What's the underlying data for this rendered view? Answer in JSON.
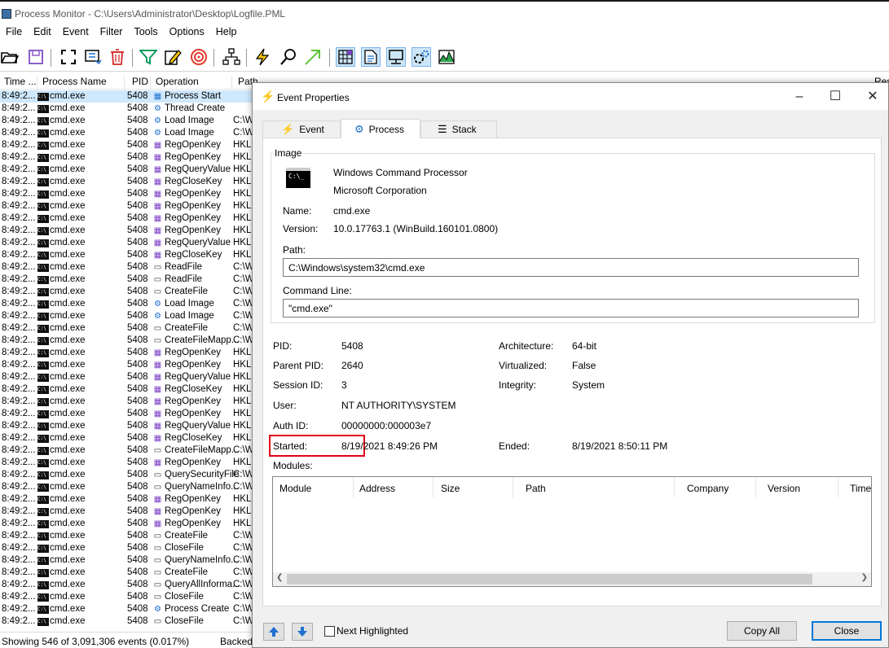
{
  "window": {
    "title": "Process Monitor - C:\\Users\\Administrator\\Desktop\\Logfile.PML"
  },
  "menu": [
    "File",
    "Edit",
    "Event",
    "Filter",
    "Tools",
    "Options",
    "Help"
  ],
  "list": {
    "headers": {
      "time": "Time ...",
      "process": "Process Name",
      "pid": "PID",
      "operation": "Operation",
      "path": "Path",
      "result": "Res"
    },
    "rows": [
      {
        "time": "8:49:2...",
        "proc": "cmd.exe",
        "pid": "5408",
        "icon": "proc",
        "op": "Process Start",
        "path": ""
      },
      {
        "time": "8:49:2...",
        "proc": "cmd.exe",
        "pid": "5408",
        "icon": "gear",
        "op": "Thread Create",
        "path": ""
      },
      {
        "time": "8:49:2...",
        "proc": "cmd.exe",
        "pid": "5408",
        "icon": "gear",
        "op": "Load Image",
        "path": "C:\\W"
      },
      {
        "time": "8:49:2...",
        "proc": "cmd.exe",
        "pid": "5408",
        "icon": "gear",
        "op": "Load Image",
        "path": "C:\\W"
      },
      {
        "time": "8:49:2...",
        "proc": "cmd.exe",
        "pid": "5408",
        "icon": "reg",
        "op": "RegOpenKey",
        "path": "HKLI"
      },
      {
        "time": "8:49:2...",
        "proc": "cmd.exe",
        "pid": "5408",
        "icon": "reg",
        "op": "RegOpenKey",
        "path": "HKLI"
      },
      {
        "time": "8:49:2...",
        "proc": "cmd.exe",
        "pid": "5408",
        "icon": "reg",
        "op": "RegQueryValue",
        "path": "HKLI"
      },
      {
        "time": "8:49:2...",
        "proc": "cmd.exe",
        "pid": "5408",
        "icon": "reg",
        "op": "RegCloseKey",
        "path": "HKLI"
      },
      {
        "time": "8:49:2...",
        "proc": "cmd.exe",
        "pid": "5408",
        "icon": "reg",
        "op": "RegOpenKey",
        "path": "HKLI"
      },
      {
        "time": "8:49:2...",
        "proc": "cmd.exe",
        "pid": "5408",
        "icon": "reg",
        "op": "RegOpenKey",
        "path": "HKLI"
      },
      {
        "time": "8:49:2...",
        "proc": "cmd.exe",
        "pid": "5408",
        "icon": "reg",
        "op": "RegOpenKey",
        "path": "HKLI"
      },
      {
        "time": "8:49:2...",
        "proc": "cmd.exe",
        "pid": "5408",
        "icon": "reg",
        "op": "RegOpenKey",
        "path": "HKLI"
      },
      {
        "time": "8:49:2...",
        "proc": "cmd.exe",
        "pid": "5408",
        "icon": "reg",
        "op": "RegQueryValue",
        "path": "HKLI"
      },
      {
        "time": "8:49:2...",
        "proc": "cmd.exe",
        "pid": "5408",
        "icon": "reg",
        "op": "RegCloseKey",
        "path": "HKLI"
      },
      {
        "time": "8:49:2...",
        "proc": "cmd.exe",
        "pid": "5408",
        "icon": "file",
        "op": "ReadFile",
        "path": "C:\\W"
      },
      {
        "time": "8:49:2...",
        "proc": "cmd.exe",
        "pid": "5408",
        "icon": "file",
        "op": "ReadFile",
        "path": "C:\\W"
      },
      {
        "time": "8:49:2...",
        "proc": "cmd.exe",
        "pid": "5408",
        "icon": "file",
        "op": "CreateFile",
        "path": "C:\\W"
      },
      {
        "time": "8:49:2...",
        "proc": "cmd.exe",
        "pid": "5408",
        "icon": "gear",
        "op": "Load Image",
        "path": "C:\\W"
      },
      {
        "time": "8:49:2...",
        "proc": "cmd.exe",
        "pid": "5408",
        "icon": "gear",
        "op": "Load Image",
        "path": "C:\\W"
      },
      {
        "time": "8:49:2...",
        "proc": "cmd.exe",
        "pid": "5408",
        "icon": "file",
        "op": "CreateFile",
        "path": "C:\\W"
      },
      {
        "time": "8:49:2...",
        "proc": "cmd.exe",
        "pid": "5408",
        "icon": "file",
        "op": "CreateFileMapp...",
        "path": "C:\\W"
      },
      {
        "time": "8:49:2...",
        "proc": "cmd.exe",
        "pid": "5408",
        "icon": "reg",
        "op": "RegOpenKey",
        "path": "HKLI"
      },
      {
        "time": "8:49:2...",
        "proc": "cmd.exe",
        "pid": "5408",
        "icon": "reg",
        "op": "RegOpenKey",
        "path": "HKLI"
      },
      {
        "time": "8:49:2...",
        "proc": "cmd.exe",
        "pid": "5408",
        "icon": "reg",
        "op": "RegQueryValue",
        "path": "HKLI"
      },
      {
        "time": "8:49:2...",
        "proc": "cmd.exe",
        "pid": "5408",
        "icon": "reg",
        "op": "RegCloseKey",
        "path": "HKLI"
      },
      {
        "time": "8:49:2...",
        "proc": "cmd.exe",
        "pid": "5408",
        "icon": "reg",
        "op": "RegOpenKey",
        "path": "HKLI"
      },
      {
        "time": "8:49:2...",
        "proc": "cmd.exe",
        "pid": "5408",
        "icon": "reg",
        "op": "RegOpenKey",
        "path": "HKLI"
      },
      {
        "time": "8:49:2...",
        "proc": "cmd.exe",
        "pid": "5408",
        "icon": "reg",
        "op": "RegQueryValue",
        "path": "HKLI"
      },
      {
        "time": "8:49:2...",
        "proc": "cmd.exe",
        "pid": "5408",
        "icon": "reg",
        "op": "RegCloseKey",
        "path": "HKLI"
      },
      {
        "time": "8:49:2...",
        "proc": "cmd.exe",
        "pid": "5408",
        "icon": "file",
        "op": "CreateFileMapp...",
        "path": "C:\\W"
      },
      {
        "time": "8:49:2...",
        "proc": "cmd.exe",
        "pid": "5408",
        "icon": "reg",
        "op": "RegOpenKey",
        "path": "HKLI"
      },
      {
        "time": "8:49:2...",
        "proc": "cmd.exe",
        "pid": "5408",
        "icon": "file",
        "op": "QuerySecurityFile",
        "path": "C:\\W"
      },
      {
        "time": "8:49:2...",
        "proc": "cmd.exe",
        "pid": "5408",
        "icon": "file",
        "op": "QueryNameInfo...",
        "path": "C:\\W"
      },
      {
        "time": "8:49:2...",
        "proc": "cmd.exe",
        "pid": "5408",
        "icon": "reg",
        "op": "RegOpenKey",
        "path": "HKLI"
      },
      {
        "time": "8:49:2...",
        "proc": "cmd.exe",
        "pid": "5408",
        "icon": "reg",
        "op": "RegOpenKey",
        "path": "HKLI"
      },
      {
        "time": "8:49:2...",
        "proc": "cmd.exe",
        "pid": "5408",
        "icon": "reg",
        "op": "RegOpenKey",
        "path": "HKLI"
      },
      {
        "time": "8:49:2...",
        "proc": "cmd.exe",
        "pid": "5408",
        "icon": "file",
        "op": "CreateFile",
        "path": "C:\\W"
      },
      {
        "time": "8:49:2...",
        "proc": "cmd.exe",
        "pid": "5408",
        "icon": "file",
        "op": "CloseFile",
        "path": "C:\\W"
      },
      {
        "time": "8:49:2...",
        "proc": "cmd.exe",
        "pid": "5408",
        "icon": "file",
        "op": "QueryNameInfo...",
        "path": "C:\\W"
      },
      {
        "time": "8:49:2...",
        "proc": "cmd.exe",
        "pid": "5408",
        "icon": "file",
        "op": "CreateFile",
        "path": "C:\\W"
      },
      {
        "time": "8:49:2...",
        "proc": "cmd.exe",
        "pid": "5408",
        "icon": "file",
        "op": "QueryAllInforma...",
        "path": "C:\\W"
      },
      {
        "time": "8:49:2...",
        "proc": "cmd.exe",
        "pid": "5408",
        "icon": "file",
        "op": "CloseFile",
        "path": "C:\\W"
      },
      {
        "time": "8:49:2...",
        "proc": "cmd.exe",
        "pid": "5408",
        "icon": "gear",
        "op": "Process Create",
        "path": "C:\\W"
      },
      {
        "time": "8:49:2...",
        "proc": "cmd.exe",
        "pid": "5408",
        "icon": "file",
        "op": "CloseFile",
        "path": "C:\\W"
      }
    ]
  },
  "status": {
    "events": "Showing 546 of 3,091,306 events (0.017%)",
    "backing": "Backed"
  },
  "dialog": {
    "title": "Event Properties",
    "tabs": {
      "event": "Event",
      "process": "Process",
      "stack": "Stack"
    },
    "image_legend": "Image",
    "description": "Windows Command Processor",
    "company": "Microsoft Corporation",
    "name_label": "Name:",
    "name": "cmd.exe",
    "version_label": "Version:",
    "version": "10.0.17763.1 (WinBuild.160101.0800)",
    "path_label": "Path:",
    "path": "C:\\Windows\\system32\\cmd.exe",
    "cmdline_label": "Command Line:",
    "cmdline": "\"cmd.exe\"",
    "pid_label": "PID:",
    "pid": "5408",
    "ppid_label": "Parent PID:",
    "ppid": "2640",
    "session_label": "Session ID:",
    "session": "3",
    "user_label": "User:",
    "user": "NT AUTHORITY\\SYSTEM",
    "auth_label": "Auth ID:",
    "auth": "00000000:000003e7",
    "started_label": "Started:",
    "started": "8/19/2021 8:49:26 PM",
    "arch_label": "Architecture:",
    "arch": "64-bit",
    "virt_label": "Virtualized:",
    "virt": "False",
    "integ_label": "Integrity:",
    "integ": "System",
    "ended_label": "Ended:",
    "ended": "8/19/2021 8:50:11 PM",
    "modules_label": "Modules:",
    "module_cols": {
      "module": "Module",
      "address": "Address",
      "size": "Size",
      "path": "Path",
      "company": "Company",
      "version": "Version",
      "time": "Time"
    },
    "next_highlighted": "Next Highlighted",
    "copy_all": "Copy All",
    "close": "Close"
  },
  "colors": {
    "selection": "#cfe8fc",
    "highlight_box": "#e0001b",
    "accent": "#0078d7"
  }
}
